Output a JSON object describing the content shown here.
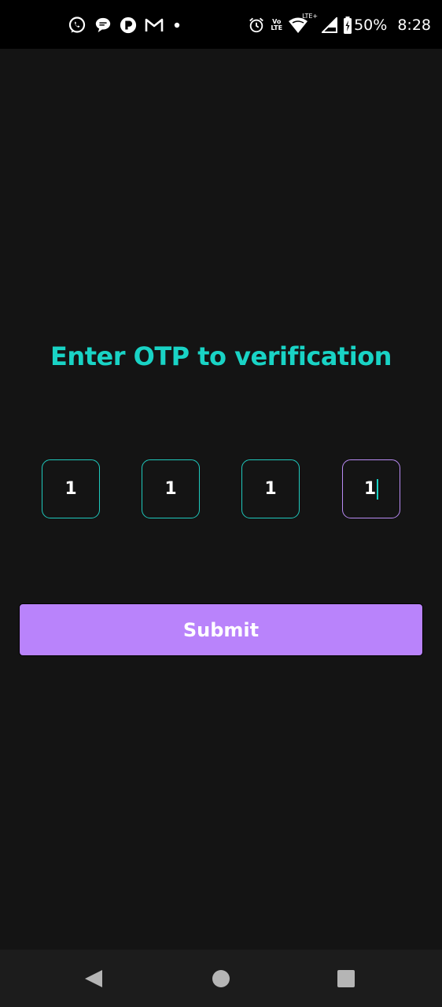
{
  "status_bar": {
    "left_icons": [
      "whatsapp-icon",
      "chat-bubble-icon",
      "app-notification-icon",
      "gmail-icon",
      "more-notifications-dot-icon"
    ],
    "right_icons": [
      "alarm-icon",
      "volte-icon",
      "wifi-icon",
      "cell-signal-icon",
      "battery-charging-icon"
    ],
    "lte_label": "LTE+",
    "volte_label_top": "Vo",
    "volte_label_bottom": "LTE",
    "battery_percent": "50%",
    "time": "8:28"
  },
  "screen": {
    "title": "Enter OTP to verification",
    "otp_digits": [
      "1",
      "1",
      "1",
      "1"
    ],
    "focused_index": 3,
    "submit_label": "Submit"
  },
  "colors": {
    "background": "#141414",
    "title": "#19d3c5",
    "otp_border": "#1fc9bd",
    "otp_focused_border": "#b98bf5",
    "submit_background": "#b983fb"
  },
  "nav_bar": {
    "buttons": [
      "back-triangle-icon",
      "home-circle-icon",
      "recents-square-icon"
    ]
  }
}
